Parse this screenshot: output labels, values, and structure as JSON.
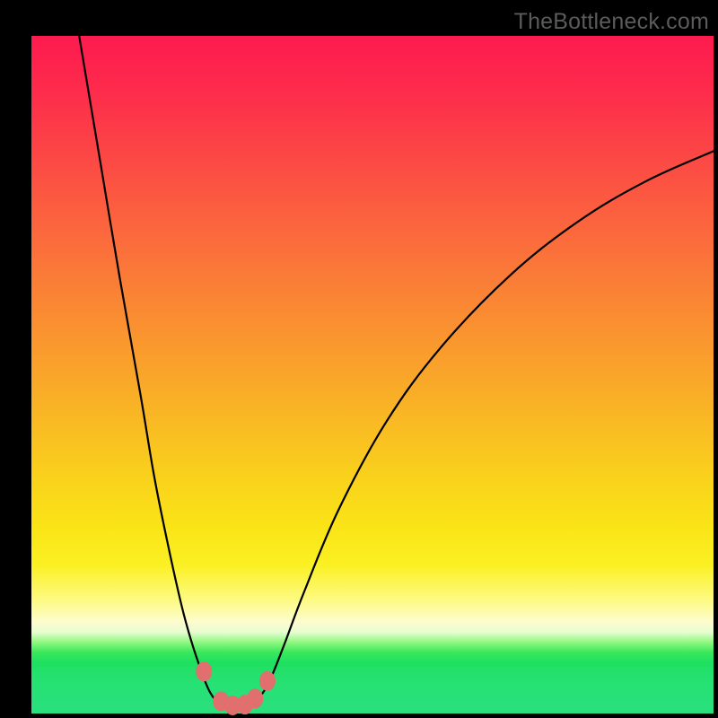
{
  "watermark": "TheBottleneck.com",
  "chart_data": {
    "type": "line",
    "title": "",
    "xlabel": "",
    "ylabel": "",
    "ylim": [
      0,
      100
    ],
    "xlim": [
      0,
      100
    ],
    "series": [
      {
        "name": "left-branch",
        "x": [
          7,
          10,
          13,
          16,
          18,
          20,
          22,
          23.5,
          25,
          26,
          27,
          28
        ],
        "y": [
          100,
          82,
          64,
          47,
          35,
          25,
          16,
          10.5,
          6,
          3.5,
          2,
          1.5
        ]
      },
      {
        "name": "right-branch",
        "x": [
          32,
          33.5,
          35,
          37,
          40,
          45,
          52,
          60,
          70,
          80,
          90,
          100
        ],
        "y": [
          1.5,
          2.5,
          5,
          10,
          18,
          30,
          43,
          54,
          64.5,
          72.5,
          78.5,
          83
        ]
      },
      {
        "name": "trough",
        "x": [
          28,
          29,
          30,
          31,
          32
        ],
        "y": [
          1.5,
          1.2,
          1.1,
          1.2,
          1.5
        ]
      }
    ],
    "markers": {
      "name": "highlight-points",
      "points": [
        {
          "x": 25.3,
          "y": 6.2
        },
        {
          "x": 27.8,
          "y": 1.8
        },
        {
          "x": 29.5,
          "y": 1.2
        },
        {
          "x": 31.3,
          "y": 1.3
        },
        {
          "x": 32.8,
          "y": 2.2
        },
        {
          "x": 34.6,
          "y": 4.8
        }
      ],
      "color": "#e06f6d"
    },
    "gradient_stops": [
      {
        "pos": 0.0,
        "color": "#fd1b4f"
      },
      {
        "pos": 0.42,
        "color": "#fa8e31"
      },
      {
        "pos": 0.72,
        "color": "#fae317"
      },
      {
        "pos": 0.86,
        "color": "#fdfccf"
      },
      {
        "pos": 0.91,
        "color": "#39e75b"
      },
      {
        "pos": 1.0,
        "color": "#2ae07e"
      }
    ]
  }
}
